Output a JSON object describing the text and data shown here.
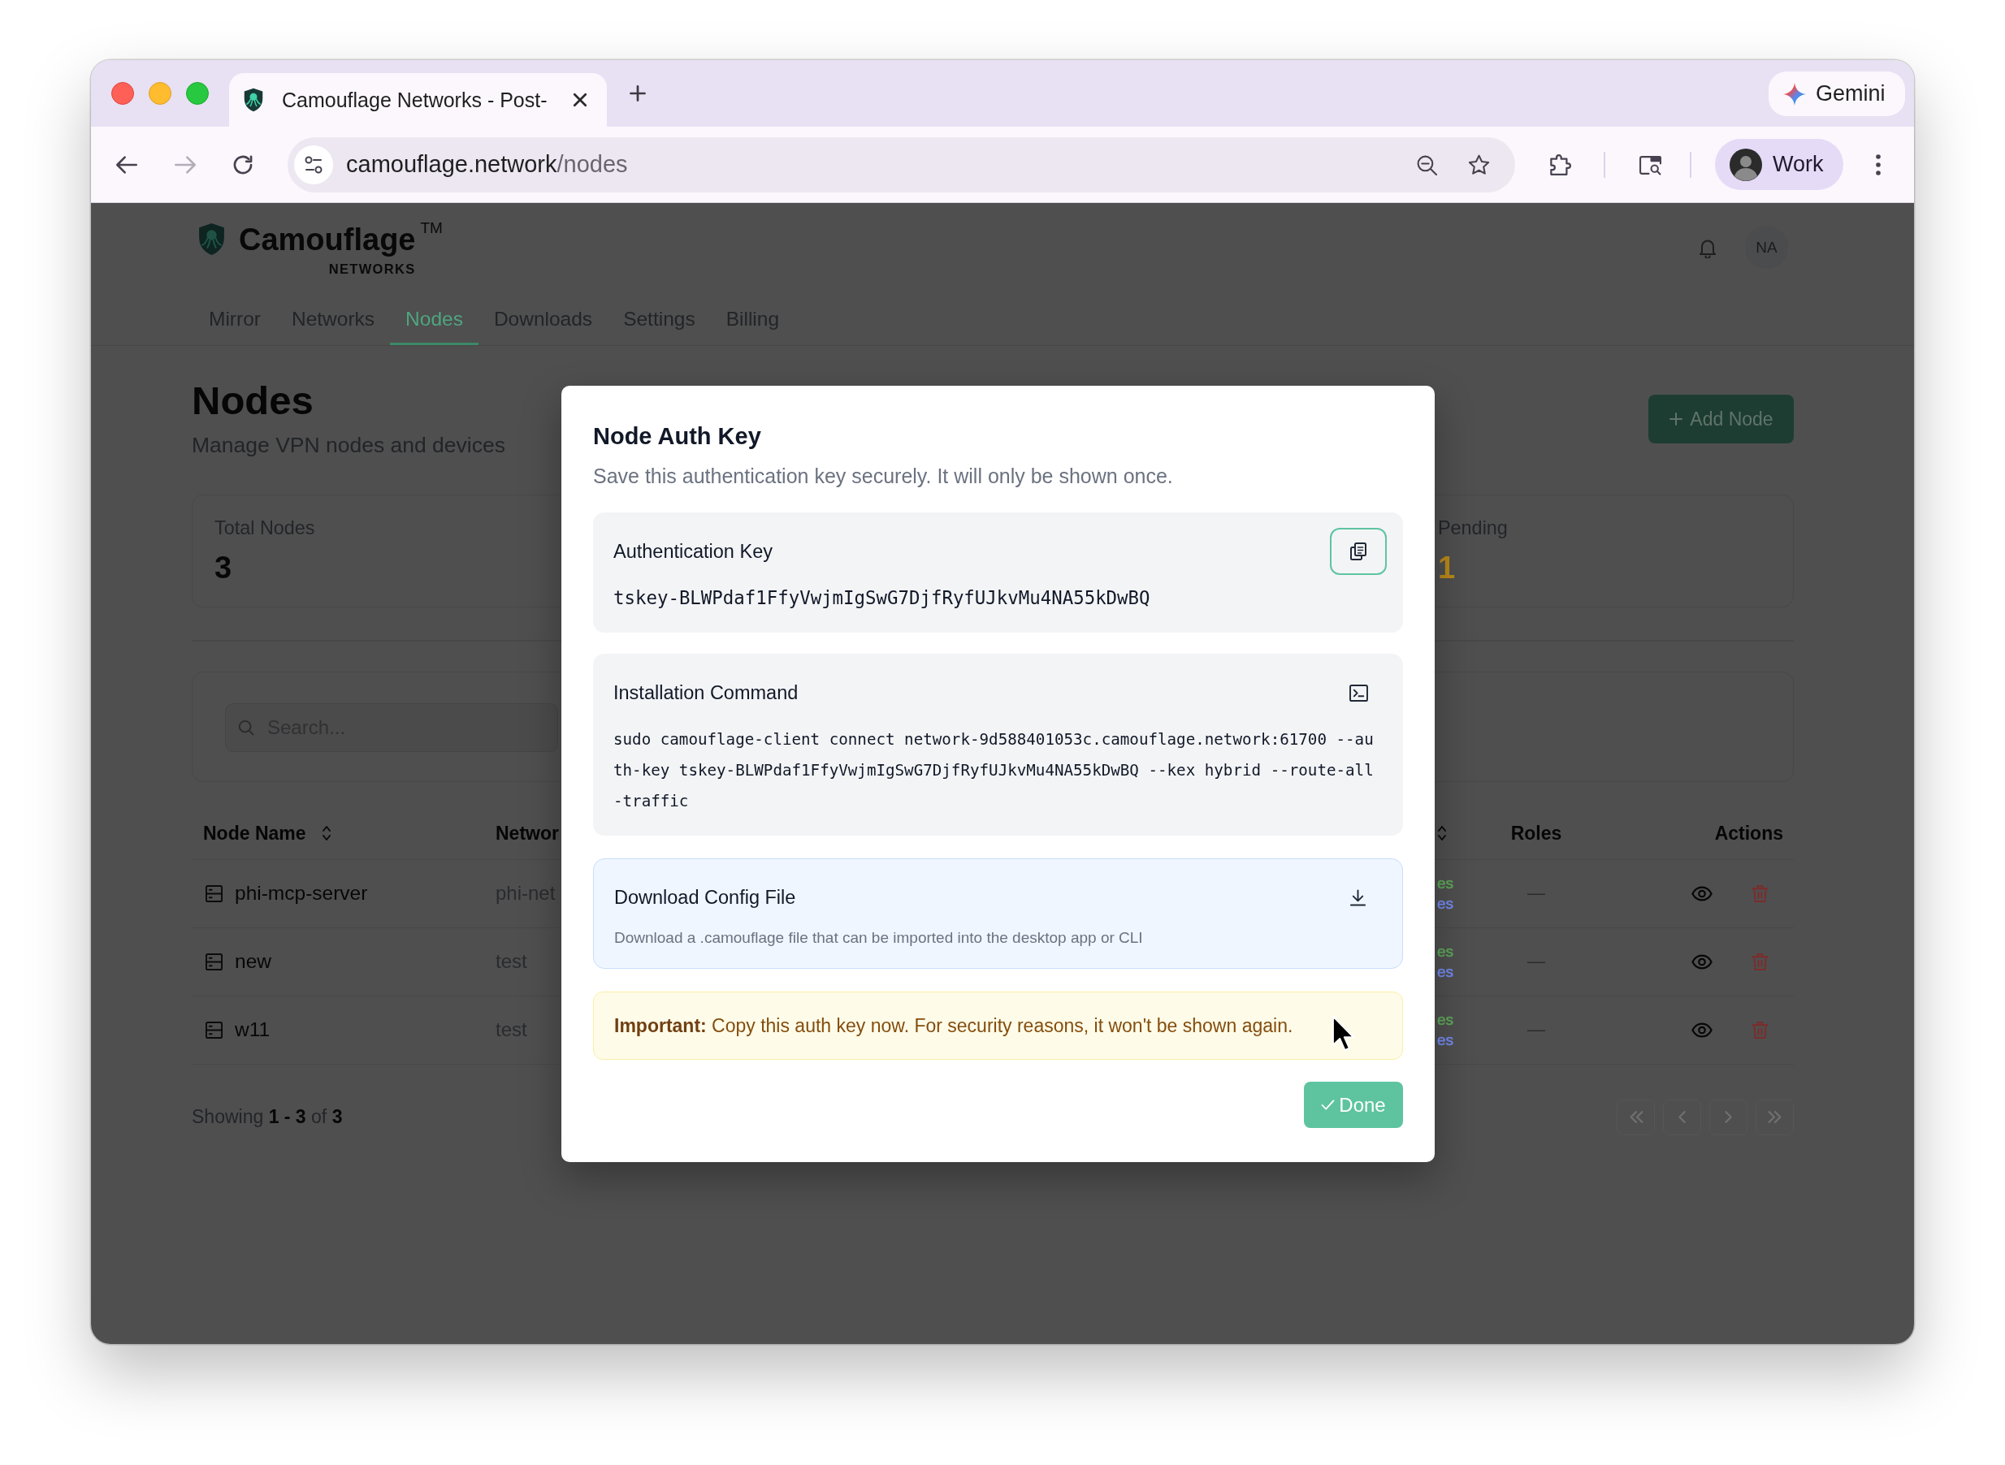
{
  "browser": {
    "tab_title": "Camouflage Networks - Post-",
    "assistant_button": "Gemini",
    "nav_buttons": [
      {
        "kind": "back",
        "disabled": false
      },
      {
        "kind": "forward",
        "disabled": true
      },
      {
        "kind": "reload",
        "disabled": false
      }
    ],
    "url": "camouflage.network/nodes",
    "profile": "Work"
  },
  "app": {
    "logo": {
      "name": "Camouflage",
      "mark": "TM",
      "tagline": "NETWORKS"
    },
    "user_initials": "NA",
    "nav": [
      {
        "label": "Mirror",
        "selected": false
      },
      {
        "label": "Networks",
        "selected": false
      },
      {
        "label": "Nodes",
        "selected": true
      },
      {
        "label": "Downloads",
        "selected": false
      },
      {
        "label": "Settings",
        "selected": false
      },
      {
        "label": "Billing",
        "selected": false
      }
    ],
    "title": "Nodes",
    "subtitle": "Manage VPN nodes and devices",
    "add_button": "Add Node",
    "stats": [
      {
        "kind": "total",
        "label": "Total Nodes",
        "value": "3"
      },
      {
        "kind": "pending",
        "label": "Pending",
        "value": "1"
      }
    ],
    "search": {
      "placeholder": "Search..."
    },
    "table": {
      "columns": [
        {
          "label": "Node Name",
          "sortable": true
        },
        {
          "label": "Networ",
          "sortable": false
        },
        {
          "sortable": true
        },
        {
          "label": "Roles",
          "sortable": false
        },
        {
          "label": "Actions",
          "sortable": false
        }
      ],
      "rows": [
        {
          "name": "phi-mcp-server",
          "network": "phi-net",
          "column_3": [
            {
              "text": "es",
              "color": "#5fa85a"
            },
            {
              "text": "es",
              "color": "#7489ee"
            }
          ],
          "roles": "—"
        },
        {
          "name": "new",
          "network": "test",
          "column_3": [
            {
              "text": "es",
              "color": "#5fa85a"
            },
            {
              "text": "es",
              "color": "#7489ee"
            }
          ],
          "roles": "—"
        },
        {
          "name": "w11",
          "network": "test",
          "column_3": [
            {
              "text": "es",
              "color": "#5fa85a"
            },
            {
              "text": "es",
              "color": "#7489ee"
            }
          ],
          "roles": "—"
        }
      ]
    },
    "summary": "Showing **1 - 3** of **3**",
    "pagination": [
      {
        "kind": "first",
        "disabled": true
      },
      {
        "kind": "prev",
        "disabled": true
      },
      {
        "kind": "next",
        "disabled": true
      },
      {
        "kind": "last",
        "disabled": true
      }
    ]
  },
  "modal": {
    "title": "Node Auth Key",
    "description": "Save this authentication key securely. It will only be shown once.",
    "auth_key": {
      "label": "Authentication Key",
      "value": "tskey-BLWPdaf1FfyVwjmIgSwG7DjfRyfUJkvMu4NA55kDwBQ"
    },
    "command": {
      "label": "Installation Command",
      "value": "sudo camouflage-client connect network-9d588401053c.camouflage.network:61700 --auth-key tskey-BLWPdaf1FfyVwjmIgSwG7DjfRyfUJkvMu4NA55kDwBQ --kex hybrid --route-all-traffic"
    },
    "download": {
      "title": "Download Config File",
      "description": "Download a .camouflage file that can be imported into the desktop app or CLI"
    },
    "note": "**Important:** Copy this auth key now. For security reasons, it won't be shown again.",
    "done_button": "Done"
  }
}
